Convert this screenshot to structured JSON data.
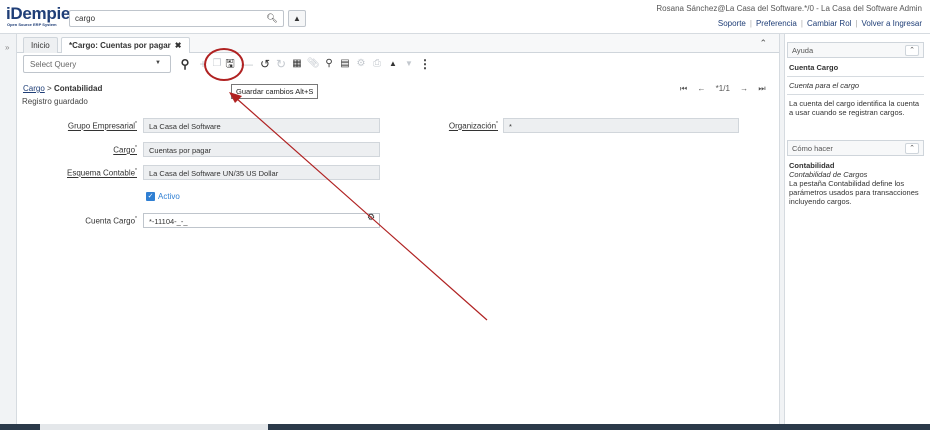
{
  "app": {
    "logo": "iDempiere",
    "logo_tagline": "Open Source ERP System",
    "search_value": "cargo",
    "user_line": "Rosana Sánchez@La Casa del Software.*/0 - La Casa del Software Admin",
    "links": [
      "Soporte",
      "Preferencia",
      "Cambiar Rol",
      "Volver a Ingresar"
    ]
  },
  "tabs": [
    {
      "label": "Inicio"
    },
    {
      "label": "*Cargo: Cuentas por pagar"
    }
  ],
  "toolbar": {
    "select_query": "Select Query",
    "tooltip": "Guardar cambios   Alt+S"
  },
  "breadcrumb": {
    "parent": "Cargo",
    "separator": ">",
    "current": "Contabilidad"
  },
  "record_nav": {
    "position": "*1/1"
  },
  "status": "Registro guardado",
  "form": {
    "grupo_label": "Grupo Empresarial",
    "grupo_value": "La Casa del Software",
    "org_label": "Organización",
    "org_value": "*",
    "cargo_label": "Cargo",
    "cargo_value": "Cuentas por pagar",
    "esquema_label": "Esquema Contable",
    "esquema_value": "La Casa del Software UN/35 US Dollar",
    "activo_label": "Activo",
    "cuenta_label": "Cuenta Cargo",
    "cuenta_value": "*-11104-_-_",
    "required_mark": "*"
  },
  "help_panel": {
    "title": "Ayuda",
    "field_name": "Cuenta Cargo",
    "field_desc": "Cuenta para el cargo",
    "field_help": "La cuenta del cargo identifica la cuenta a usar cuando se registran cargos.",
    "howto_title": "Cómo hacer",
    "tab_name": "Contabilidad",
    "tab_desc": "Contabilidad de Cargos",
    "tab_help": "La pestaña Contabilidad define los parámetros usados para transacciones incluyendo cargos."
  },
  "colors": {
    "accent": "#1f3e77",
    "annotation": "#b02222",
    "checkbox": "#2f7fd3"
  }
}
